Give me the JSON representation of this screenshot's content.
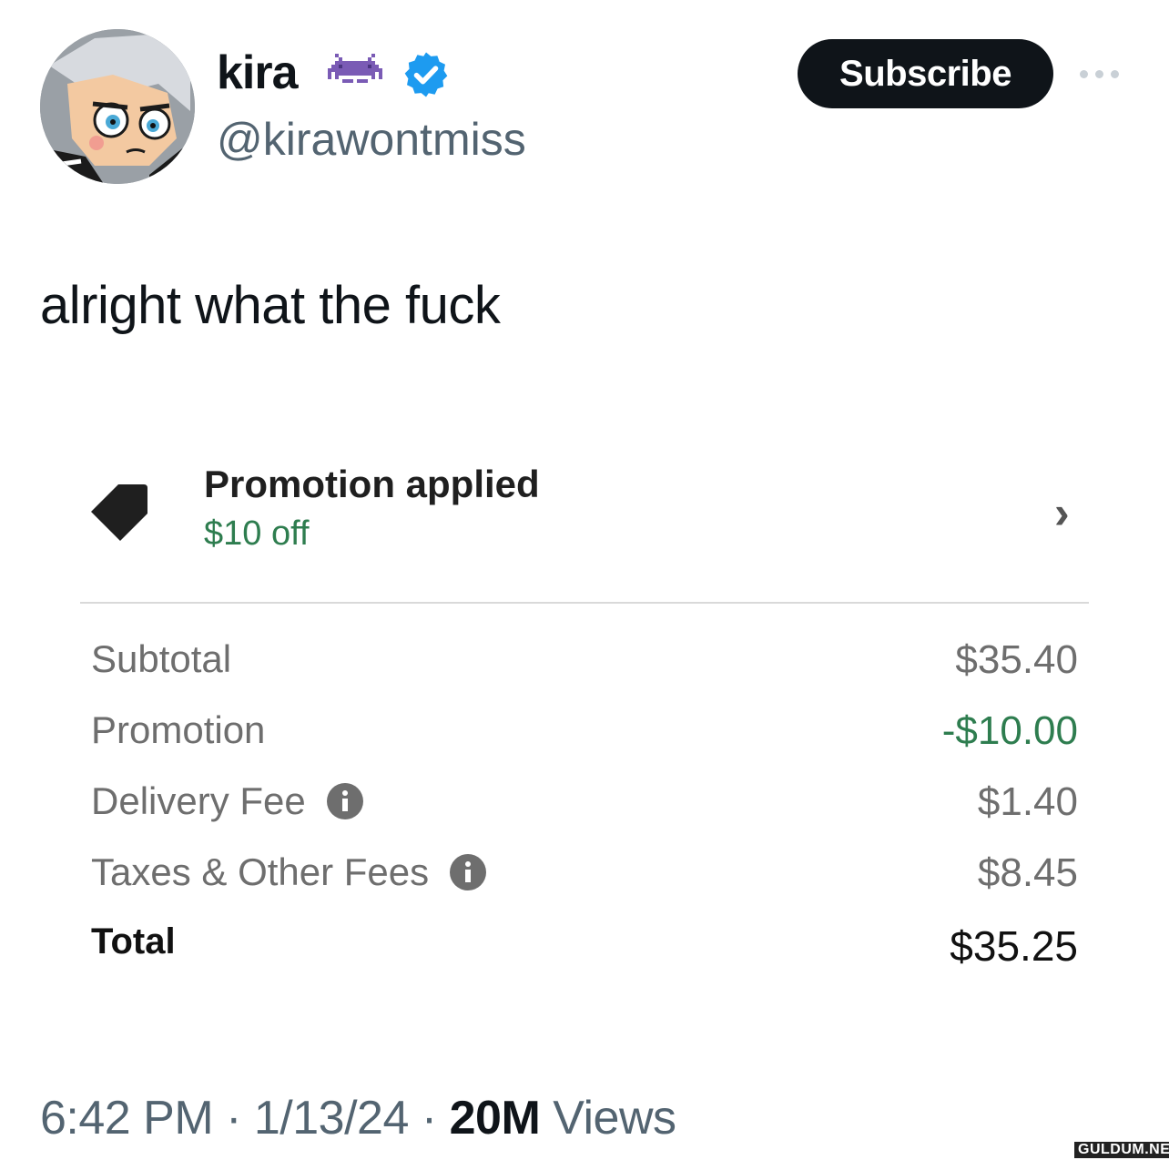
{
  "header": {
    "display_name": "kira",
    "emoji_icon": "alien-monster-icon",
    "verified_icon": "verified-badge-icon",
    "handle": "@kirawontmiss",
    "subscribe_label": "Subscribe",
    "more_icon": "more-options-icon"
  },
  "tweet": {
    "text": "alright what the fuck"
  },
  "receipt": {
    "promotion_title": "Promotion applied",
    "promotion_subtitle": "$10 off",
    "tag_icon": "price-tag-icon",
    "chevron_icon": "chevron-right-icon",
    "rows": [
      {
        "label": "Subtotal",
        "value": "$35.40",
        "info": false
      },
      {
        "label": "Promotion",
        "value": "-$10.00",
        "info": false
      },
      {
        "label": "Delivery Fee",
        "value": "$1.40",
        "info": true
      },
      {
        "label": "Taxes & Other Fees",
        "value": "$8.45",
        "info": true
      }
    ],
    "total_label": "Total",
    "total_value": "$35.25"
  },
  "footer": {
    "time": "6:42 PM",
    "date": "1/13/24",
    "separator": "·",
    "views_count": "20M",
    "views_label": "Views"
  },
  "watermark": "GULDUM.NET",
  "colors": {
    "promo_green": "#2e7d4f",
    "verified_blue": "#1d9bf0",
    "text_dark": "#0f1419",
    "text_muted": "#536471"
  }
}
